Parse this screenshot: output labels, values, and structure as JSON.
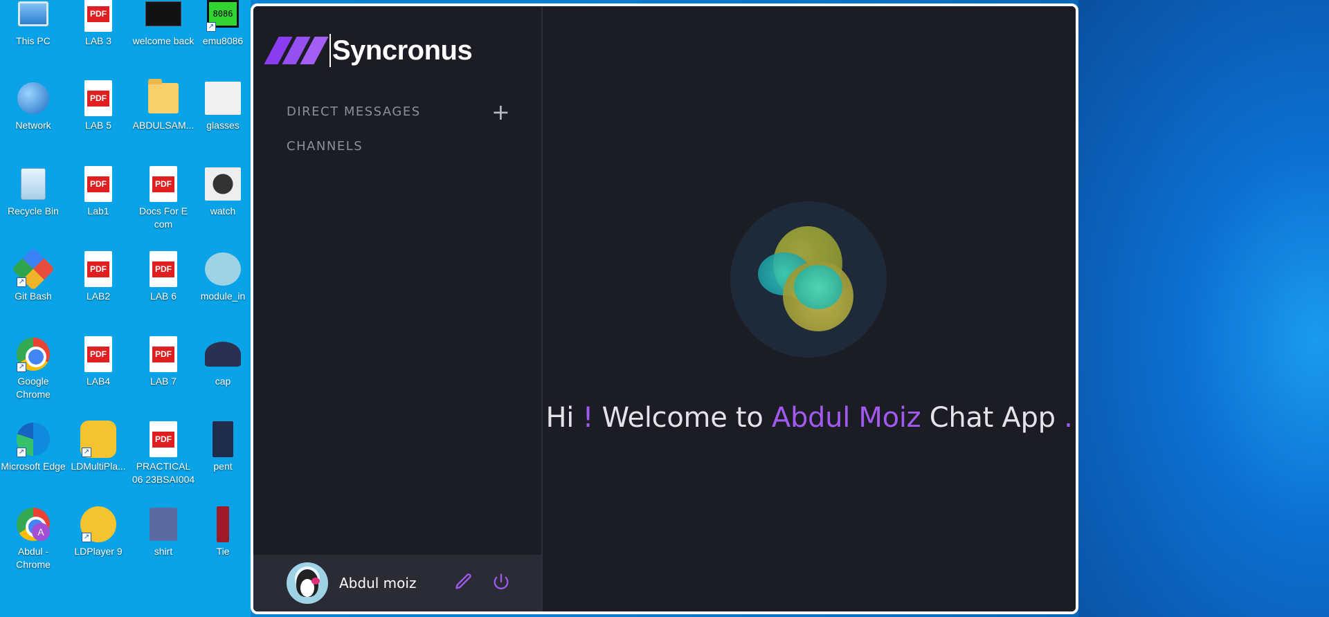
{
  "desktop": {
    "icons": [
      {
        "label": "This PC",
        "icon": "monitor-icon"
      },
      {
        "label": "LAB 3",
        "icon": "pdf-icon"
      },
      {
        "label": "welcome back",
        "icon": "image-thumbnail-icon"
      },
      {
        "label": "emu8086",
        "icon": "chip-icon"
      },
      {
        "label": "Network",
        "icon": "network-icon"
      },
      {
        "label": "LAB 5",
        "icon": "pdf-icon"
      },
      {
        "label": "ABDULSAM...",
        "icon": "folder-icon"
      },
      {
        "label": "glasses",
        "icon": "image-thumbnail-icon"
      },
      {
        "label": "Recycle Bin",
        "icon": "recycle-bin-icon"
      },
      {
        "label": "Lab1",
        "icon": "pdf-icon"
      },
      {
        "label": "Docs For E com",
        "icon": "pdf-icon"
      },
      {
        "label": "watch",
        "icon": "image-thumbnail-icon"
      },
      {
        "label": "Git Bash",
        "icon": "git-icon"
      },
      {
        "label": "LAB2",
        "icon": "pdf-icon"
      },
      {
        "label": "LAB 6",
        "icon": "pdf-icon"
      },
      {
        "label": "module_in",
        "icon": "image-thumbnail-icon"
      },
      {
        "label": "Google Chrome",
        "icon": "chrome-icon"
      },
      {
        "label": "LAB4",
        "icon": "pdf-icon"
      },
      {
        "label": "LAB 7",
        "icon": "pdf-icon"
      },
      {
        "label": "cap",
        "icon": "image-thumbnail-icon"
      },
      {
        "label": "Microsoft Edge",
        "icon": "edge-icon"
      },
      {
        "label": "LDMultiPla...",
        "icon": "ldmultiplayer-icon"
      },
      {
        "label": "PRACTICAL 06 23BSAI004",
        "icon": "pdf-icon"
      },
      {
        "label": "pent",
        "icon": "image-thumbnail-icon"
      },
      {
        "label": "Abdul - Chrome",
        "icon": "chrome-profile-icon"
      },
      {
        "label": "LDPlayer 9",
        "icon": "ldplayer-icon"
      },
      {
        "label": "shirt",
        "icon": "image-thumbnail-icon"
      },
      {
        "label": "Tie",
        "icon": "image-thumbnail-icon"
      }
    ],
    "pdf_badge": "PDF",
    "chip_text": "8086",
    "profile_badge": "A"
  },
  "app": {
    "brand_name": "Syncronus",
    "sections": {
      "direct_messages": "DIRECT MESSAGES",
      "channels": "CHANNELS"
    },
    "add_symbol": "+",
    "user": {
      "name": "Abdul moiz"
    },
    "welcome": {
      "part1": "Hi ",
      "bang": "!",
      "part2": " Welcome to ",
      "name": "Abdul Moiz",
      "part3": " Chat App ",
      "dot": "."
    },
    "colors": {
      "accent": "#a259f0",
      "background": "#1b1c24",
      "profile_bar": "#2a2b35"
    }
  }
}
